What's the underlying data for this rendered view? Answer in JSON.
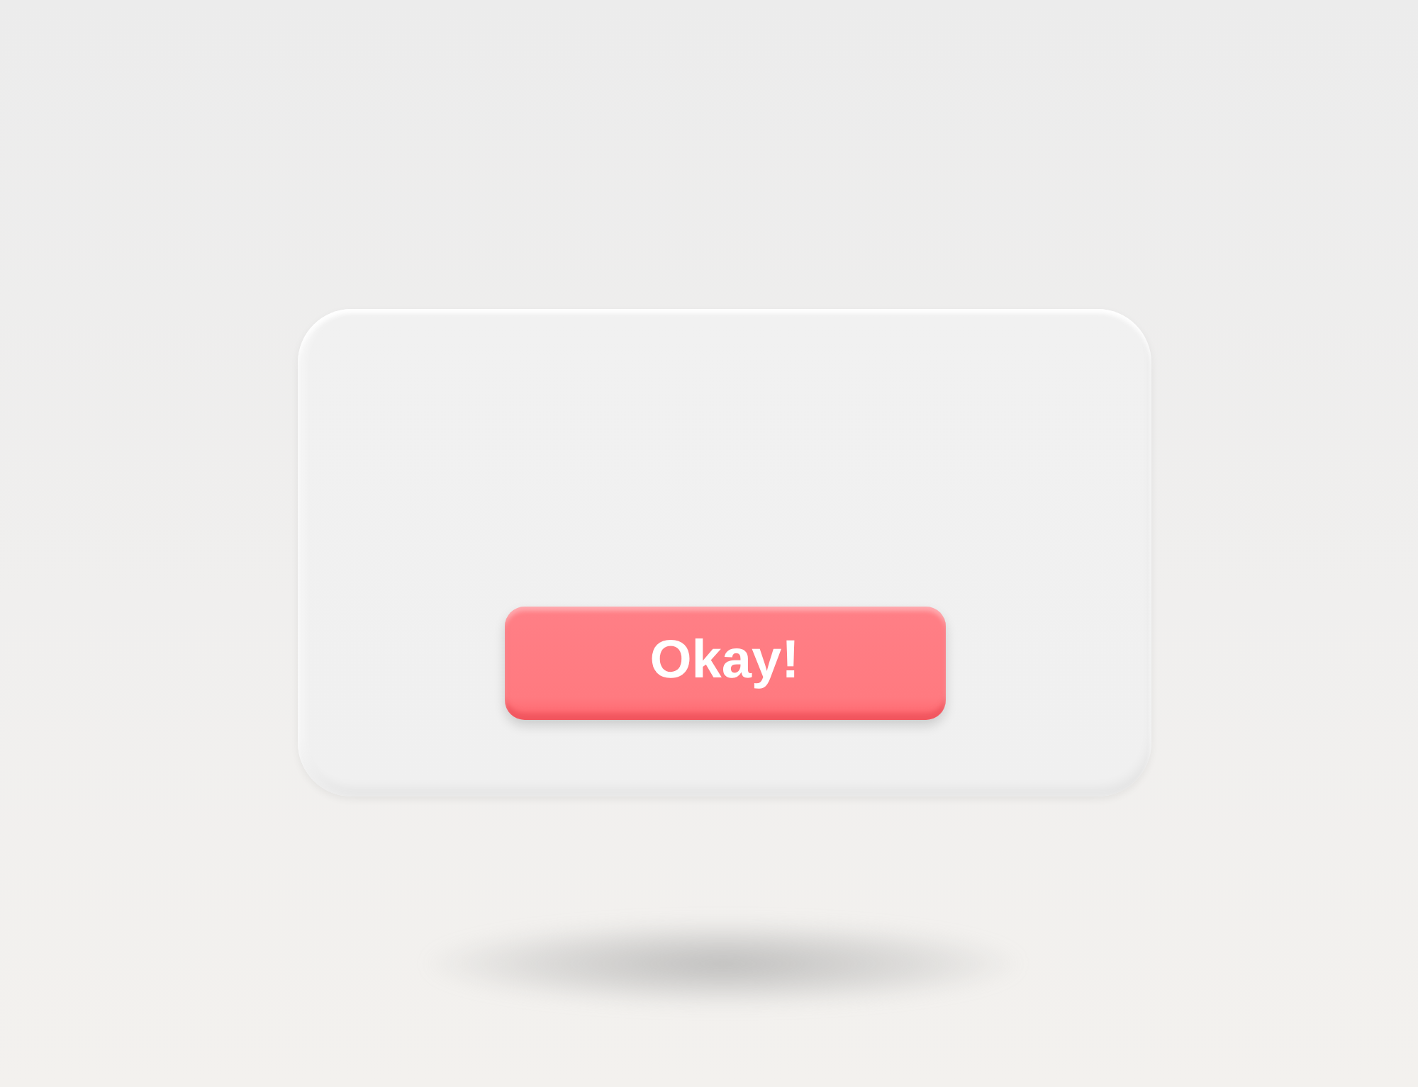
{
  "dialog": {
    "button": {
      "label": "Okay!"
    }
  }
}
